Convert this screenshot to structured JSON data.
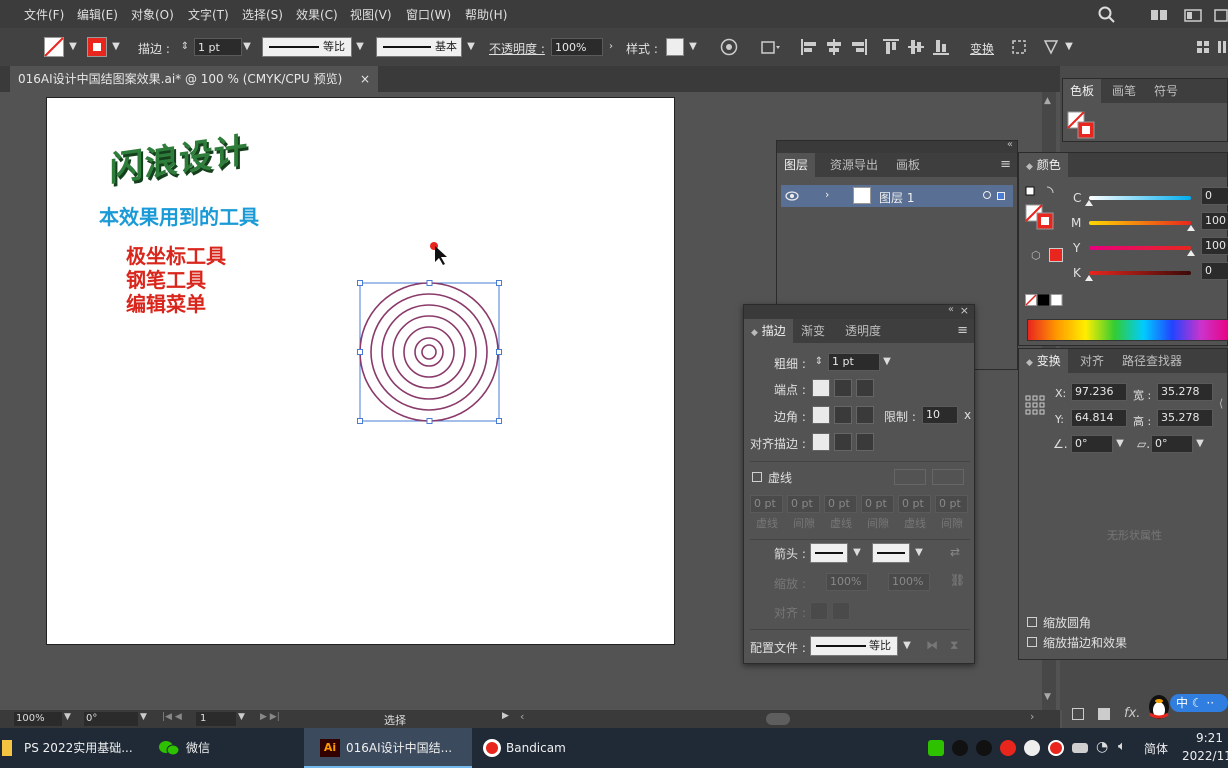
{
  "menu": [
    "文件(F)",
    "编辑(E)",
    "对象(O)",
    "文字(T)",
    "选择(S)",
    "效果(C)",
    "视图(V)",
    "窗口(W)",
    "帮助(H)"
  ],
  "toolbar": {
    "stroke_label": "描边 :",
    "stroke_weight": "1 pt",
    "profile_label": "等比",
    "brush_label": "基本",
    "opacity_label": "不透明度 :",
    "opacity_value": "100%",
    "style_label": "样式 :",
    "transform_label": "变换"
  },
  "document_tab": {
    "title": "016AI设计中国结图案效果.ai* @ 100 % (CMYK/CPU 预览)",
    "close": "×"
  },
  "canvas": {
    "logo_text": "闪浪设计",
    "heading": "本效果用到的工具",
    "tools": [
      "极坐标工具",
      "钢笔工具",
      "编辑菜单"
    ]
  },
  "swatches_panel": {
    "tabs": [
      "色板",
      "画笔",
      "符号"
    ]
  },
  "layers_panel": {
    "tabs": [
      "图层",
      "资源导出",
      "画板"
    ],
    "layer_name": "图层 1"
  },
  "color_panel": {
    "title": "颜色",
    "channels": [
      {
        "label": "C",
        "value": "0",
        "level": 0
      },
      {
        "label": "M",
        "value": "100",
        "level": 100
      },
      {
        "label": "Y",
        "value": "100",
        "level": 100
      },
      {
        "label": "K",
        "value": "0",
        "level": 0
      }
    ]
  },
  "stroke_panel": {
    "tabs": [
      "描边",
      "渐变",
      "透明度"
    ],
    "weight_label": "粗细 :",
    "weight_value": "1 pt",
    "cap_label": "端点 :",
    "corner_label": "边角 :",
    "limit_label": "限制 :",
    "limit_value": "10",
    "limit_unit": "x",
    "align_label": "对齐描边 :",
    "dashed_label": "虚线",
    "dash_values": [
      "0 pt",
      "0 pt",
      "0 pt",
      "0 pt",
      "0 pt",
      "0 pt"
    ],
    "dash_labels": [
      "虚线",
      "间隙",
      "虚线",
      "间隙",
      "虚线",
      "间隙"
    ],
    "arrow_label": "箭头 :",
    "scale_label": "缩放 :",
    "scale_values": [
      "100%",
      "100%"
    ],
    "align2_label": "对齐 :",
    "profile_label": "配置文件 :",
    "profile_value": "等比"
  },
  "transform_panel": {
    "tabs": [
      "变换",
      "对齐",
      "路径查找器"
    ],
    "x_label": "X:",
    "x_value": "97.236 mm",
    "y_label": "Y:",
    "y_value": "64.814 mm",
    "w_label": "宽 :",
    "w_value": "35.278 mm",
    "h_label": "高 :",
    "h_value": "35.278 mm",
    "angle_value": "0°",
    "shear_value": "0°",
    "no_shape": "无形状属性",
    "scale_corners": "缩放圆角",
    "scale_strokes": "缩放描边和效果"
  },
  "statusbar": {
    "zoom": "100%",
    "rotation": "0°",
    "artboard": "1",
    "tool": "选择"
  },
  "taskbar": {
    "items": [
      "PS 2022实用基础...",
      "微信",
      "016AI设计中国结...",
      "Bandicam"
    ],
    "ime": "简体",
    "ime_badge": "中",
    "time": "9:21",
    "date": "2022/11"
  },
  "colors": {
    "accent_red": "#e8261e",
    "heading_blue": "#1a9ad6",
    "tool_red": "#d9261c",
    "logo_green": "#2e7d3a",
    "selection_blue": "#4a7cd6",
    "circle_stroke": "#8a3a6a"
  }
}
